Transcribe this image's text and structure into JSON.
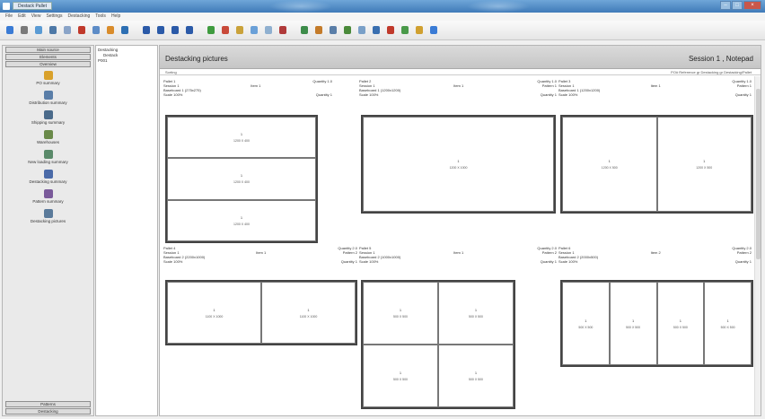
{
  "window": {
    "title": "Destack Pallet"
  },
  "menu": [
    "File",
    "Edit",
    "View",
    "Settings",
    "Destacking",
    "Tools",
    "Help"
  ],
  "toolbar_icons": [
    {
      "name": "open-icon",
      "color": "#3a7bd5"
    },
    {
      "name": "list-icon",
      "color": "#7a7a7a"
    },
    {
      "name": "grid-icon",
      "color": "#5a9bd4"
    },
    {
      "name": "save-icon",
      "color": "#4e79a7"
    },
    {
      "name": "copy-icon",
      "color": "#8aa4c8"
    },
    {
      "name": "print-icon",
      "color": "#c0392b"
    },
    {
      "name": "zoom-icon",
      "color": "#5d8cc7"
    },
    {
      "name": "config-icon",
      "color": "#d98c2b"
    },
    {
      "name": "chart-icon",
      "color": "#2d6fb3"
    },
    {
      "name": "first-icon",
      "color": "#2b5aa8"
    },
    {
      "name": "prev-icon",
      "color": "#2b5aa8"
    },
    {
      "name": "next-icon",
      "color": "#2b5aa8"
    },
    {
      "name": "last-icon",
      "color": "#2b5aa8"
    },
    {
      "name": "pallet-icon",
      "color": "#3f9b3f"
    },
    {
      "name": "flag-icon",
      "color": "#c94a3a"
    },
    {
      "name": "lock-icon",
      "color": "#caa23a"
    },
    {
      "name": "tag-icon",
      "color": "#6aa0d8"
    },
    {
      "name": "tools-icon",
      "color": "#8fb0d0"
    },
    {
      "name": "report-icon",
      "color": "#b03a3a"
    },
    {
      "name": "stack-icon",
      "color": "#3d8c4a"
    },
    {
      "name": "box-icon",
      "color": "#c47b2a"
    },
    {
      "name": "wrench-icon",
      "color": "#5a7ea8"
    },
    {
      "name": "truck-icon",
      "color": "#4a8a3a"
    },
    {
      "name": "cart-icon",
      "color": "#7aa0c8"
    },
    {
      "name": "map-icon",
      "color": "#3a6fb0"
    },
    {
      "name": "chart2-icon",
      "color": "#c0392b"
    },
    {
      "name": "user-icon",
      "color": "#4a9a4a"
    },
    {
      "name": "key-icon",
      "color": "#d0a030"
    },
    {
      "name": "shield-icon",
      "color": "#3a7bd5"
    }
  ],
  "sidebar": {
    "tabs": [
      "Main source",
      "Elements",
      "Overview"
    ],
    "items": [
      {
        "label": "PO summary",
        "icon": "po-icon",
        "color": "#d9a12b"
      },
      {
        "label": "Distribution summary",
        "icon": "distribution-icon",
        "color": "#5a7ea8"
      },
      {
        "label": "Shipping summary",
        "icon": "shipping-icon",
        "color": "#4a6a8a"
      },
      {
        "label": "Warehouses",
        "icon": "warehouse-icon",
        "color": "#6a8a4a"
      },
      {
        "label": "New loading summary",
        "icon": "loading-icon",
        "color": "#5a8a6a"
      },
      {
        "label": "Destacking summary",
        "icon": "destack-icon",
        "color": "#4a6aa8"
      },
      {
        "label": "Pattern summary",
        "icon": "pattern-icon",
        "color": "#7a5a9a"
      },
      {
        "label": "Destacking pictures",
        "icon": "picture-icon",
        "color": "#5a7a9a"
      }
    ],
    "footer": [
      "Patterns",
      "Destacking"
    ]
  },
  "tree": [
    "Destacking",
    "Destack",
    "P001"
  ],
  "main": {
    "title": "Destacking pictures",
    "right_title": "Session 1 , Notepad",
    "sub_left": "Sorting",
    "sub_right": "PO# Reference gr Destacking gr Destacking/Pallet"
  },
  "pallets": [
    {
      "name": "Pallet 1",
      "qty": "Quantity 1.0",
      "line2": "Session 1",
      "c2": "Item 1",
      "r2": "",
      "line3": "Baseboard 1 (275x275)",
      "line4": "Scale 100%",
      "r4": "Quantity 1",
      "cells": 3,
      "cols": 1,
      "cell_dims": [
        "1",
        "1200 X 400"
      ]
    },
    {
      "name": "Pallet 2",
      "qty": "Quantity 1.0",
      "line2": "Session 1",
      "c2": "Item 1",
      "r2": "Pattern 1",
      "line3": "Baseboard 1 (1200x1200)",
      "line4": "Scale 100%",
      "r4": "Quantity 1",
      "cells": 1,
      "cols": 1,
      "cell_dims": [
        "1",
        "1200 X 1000"
      ]
    },
    {
      "name": "Pallet 3",
      "qty": "Quantity 1.0",
      "line2": "Session 1",
      "c2": "Item 1",
      "r2": "Pattern 1",
      "line3": "Baseboard 1 (1200x1200)",
      "line4": "Scale 100%",
      "r4": "Quantity 1",
      "cells": 2,
      "cols": 2,
      "cell_dims": [
        "1",
        "1200 X 500"
      ]
    },
    {
      "name": "Pallet 4",
      "qty": "Quantity 2.0",
      "line2": "Session 1",
      "c2": "Item 1",
      "r2": "Pattern 2",
      "line3": "Baseboard 2 (2200x1000)",
      "line4": "Scale 100%",
      "r4": "Quantity 1",
      "cells": 2,
      "cols": 2,
      "cell_dims": [
        "1",
        "1100 X 1000"
      ]
    },
    {
      "name": "Pallet 5",
      "qty": "Quantity 2.0",
      "line2": "Session 1",
      "c2": "Item 1",
      "r2": "Pattern 2",
      "line3": "Baseboard 2 (1000x1000)",
      "line4": "Scale 100%",
      "r4": "Quantity 1",
      "cells": 4,
      "cols": 2,
      "cell_dims": [
        "1",
        "500 X 500"
      ]
    },
    {
      "name": "Pallet 6",
      "qty": "Quantity 2.0",
      "line2": "Session 1",
      "c2": "Item 2",
      "r2": "Pattern 2",
      "line3": "Baseboard 2 (2000x500)",
      "line4": "Scale 100%",
      "r4": "Quantity 1",
      "cells": 4,
      "cols": 4,
      "cell_dims": [
        "1",
        "500 X 500"
      ]
    }
  ]
}
